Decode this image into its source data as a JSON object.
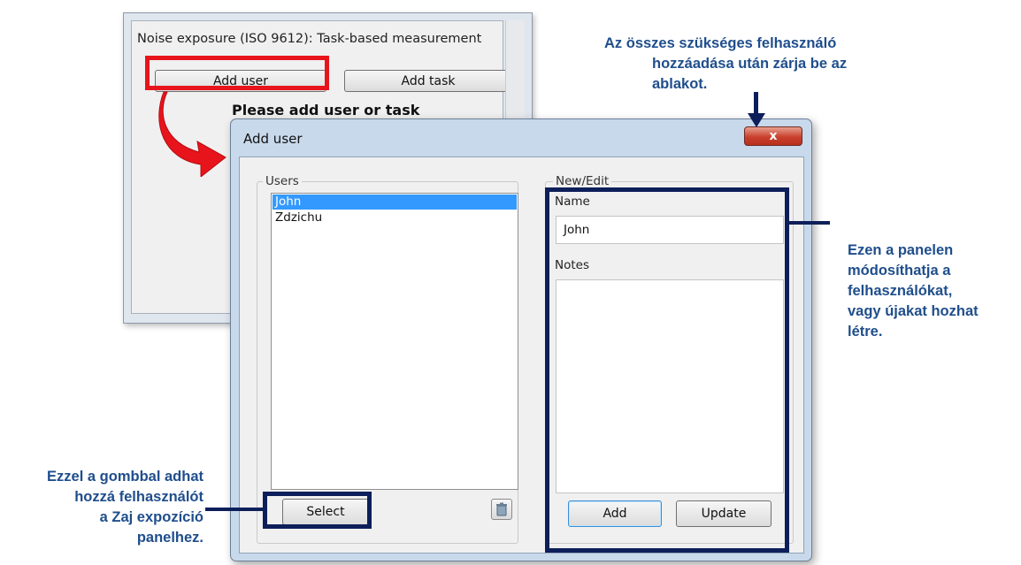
{
  "background_window": {
    "title": "Noise exposure (ISO 9612): Task-based measurement",
    "add_user_label": "Add user",
    "add_task_label": "Add task",
    "prompt": "Please add user or task"
  },
  "dialog": {
    "title": "Add user",
    "close_label": "x",
    "users_group_label": "Users",
    "users": [
      {
        "name": "John",
        "selected": true
      },
      {
        "name": "Zdzichu",
        "selected": false
      }
    ],
    "select_label": "Select",
    "edit_group_label": "New/Edit",
    "name_label": "Name",
    "name_value": "John",
    "notes_label": "Notes",
    "add_label": "Add",
    "update_label": "Update"
  },
  "annotations": {
    "close_note": {
      "line1": "Az összes szükséges felhasználó",
      "line2": "hozzáadása után zárja be az",
      "line3": "ablakot."
    },
    "panel_note": {
      "line1": "Ezen a panelen",
      "line2": "módosíthatja a",
      "line3": "felhasználókat,",
      "line4": "vagy újakat hozhat",
      "line5": "létre."
    },
    "select_note": {
      "line1": "Ezzel a gombbal adhat",
      "line2": "hozzá felhasználót",
      "line3": "a Zaj expozíció",
      "line4": "panelhez."
    }
  },
  "colors": {
    "highlight_red": "#e8141b",
    "annotation_navy": "#0d1f5a",
    "annotation_text": "#1f4e8c",
    "selection_blue": "#3399ff"
  }
}
